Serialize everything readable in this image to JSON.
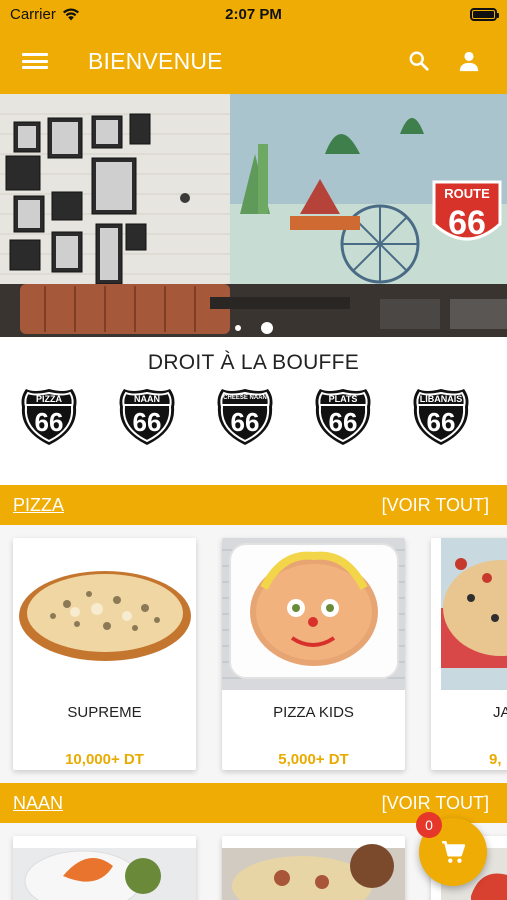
{
  "status": {
    "carrier": "Carrier",
    "time": "2:07 PM"
  },
  "appbar": {
    "title": "BIENVENUE",
    "icons": [
      "menu-icon",
      "search-icon",
      "user-icon"
    ]
  },
  "hero": {
    "slide_count": 2,
    "active_slide": 2,
    "sign_text": "ROUTE",
    "sign_number": "66"
  },
  "categories": {
    "heading": "DROIT À LA BOUFFE",
    "items": [
      {
        "top": "PIZZA",
        "num": "66"
      },
      {
        "top": "NAAN",
        "num": "66"
      },
      {
        "top": "CHEESE NAAN",
        "num": "66"
      },
      {
        "top": "PLATS",
        "num": "66"
      },
      {
        "top": "LIBANAIS",
        "num": "66"
      }
    ]
  },
  "sections": [
    {
      "name": "PIZZA",
      "see_all": "[VOIR TOUT]",
      "products": [
        {
          "name": "SUPREME",
          "price": "10,000+ DT"
        },
        {
          "name": "PIZZA KIDS",
          "price": "5,000+ DT"
        },
        {
          "name": "JA",
          "price": "9,"
        }
      ]
    },
    {
      "name": "NAAN",
      "see_all": "[VOIR TOUT]"
    }
  ],
  "cart": {
    "count": "0"
  },
  "colors": {
    "accent": "#eeac04",
    "price": "#e9ab00",
    "badge": "#e5372a"
  }
}
